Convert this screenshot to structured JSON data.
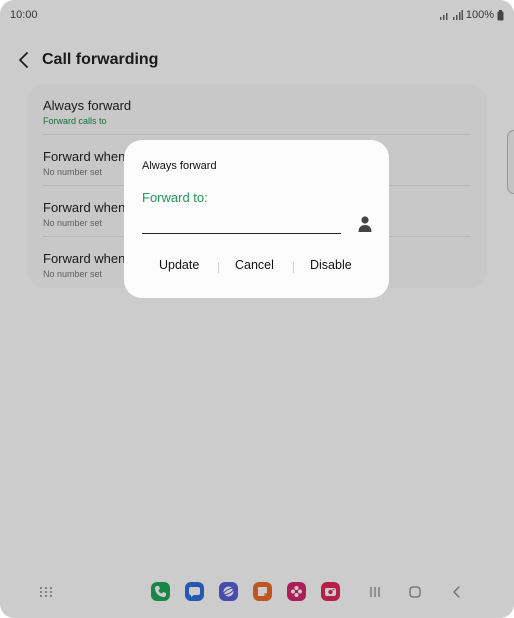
{
  "status_bar": {
    "time": "10:00",
    "battery": "100%"
  },
  "header": {
    "title": "Call forwarding"
  },
  "list": {
    "items": [
      {
        "title": "Always forward",
        "subtitle": "Forward calls to"
      },
      {
        "title": "Forward when busy",
        "subtitle": "No number set"
      },
      {
        "title": "Forward when unanswered",
        "subtitle": "No number set"
      },
      {
        "title": "Forward when unreachable",
        "subtitle": "No number set"
      }
    ]
  },
  "dialog": {
    "title": "Always forward",
    "label": "Forward to:",
    "input_value": "",
    "buttons": {
      "update": "Update",
      "cancel": "Cancel",
      "disable": "Disable"
    }
  },
  "dock": {
    "apps": [
      {
        "icon": "phone-icon",
        "color": "#1da85a"
      },
      {
        "icon": "messages-icon",
        "color": "#2f6fe0"
      },
      {
        "icon": "internet-icon",
        "color": "#5b5fd8"
      },
      {
        "icon": "notes-icon",
        "color": "#f26b2a"
      },
      {
        "icon": "flower-icon",
        "color": "#d6266d"
      },
      {
        "icon": "camera-icon",
        "color": "#e2285a"
      }
    ]
  },
  "colors": {
    "accent": "#1e9a55",
    "scrim": "rgba(0,0,0,0.2)"
  }
}
